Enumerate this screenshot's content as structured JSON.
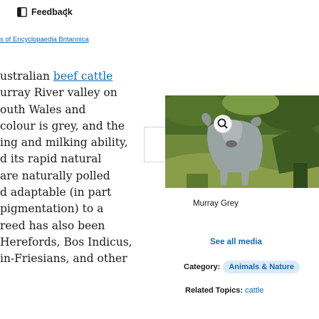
{
  "toolbar": {
    "feedback_label": "Feedback",
    "more_icon": "vertical-ellipsis-icon",
    "feedback_icon": "feedback-icon"
  },
  "citation": {
    "text": "s of Encyclopaedia Britannica"
  },
  "article": {
    "lines": [
      {
        "before": "ustralian ",
        "link": "beef cattle",
        "after": ""
      },
      {
        "before": "urray River valley on",
        "link": "",
        "after": ""
      },
      {
        "before": "outh Wales and",
        "link": "",
        "after": ""
      },
      {
        "before": " colour is grey, and the",
        "link": "",
        "after": ""
      },
      {
        "before": "ing and milking ability,",
        "link": "",
        "after": ""
      },
      {
        "before": "d its rapid natural",
        "link": "",
        "after": ""
      },
      {
        "before": " are naturally polled",
        "link": "",
        "after": ""
      },
      {
        "before": "d adaptable (in part",
        "link": "",
        "after": ""
      },
      {
        "before": "pigmentation) to a",
        "link": "",
        "after": ""
      },
      {
        "before": "reed has also been",
        "link": "",
        "after": ""
      },
      {
        "before": "Herefords, Bos Indicus,",
        "link": "",
        "after": ""
      },
      {
        "before": "in-Friesians, and other",
        "link": "",
        "after": ""
      }
    ]
  },
  "media": {
    "caption": "Murray Grey",
    "see_all_label": "See all media",
    "zoom_icon": "magnifier-icon"
  },
  "meta": {
    "category_label": "Category:",
    "category_value": "Animals & Nature",
    "related_label": "Related Topics:",
    "related_value": "cattle"
  },
  "colors": {
    "link": "#0f6ab4",
    "chip_bg": "#dbe9f7",
    "photo_green": "#5e7a2e"
  }
}
